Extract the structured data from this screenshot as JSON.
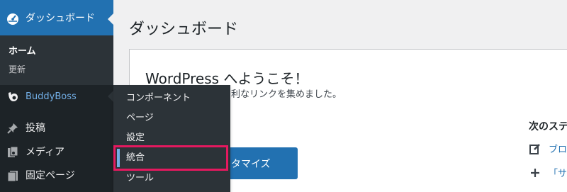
{
  "sidebar": {
    "dashboard_label": "ダッシュボード",
    "submenu": {
      "home": "ホーム",
      "update": "更新"
    },
    "items": [
      {
        "label": "BuddyBoss",
        "icon": "buddyboss-icon"
      },
      {
        "label": "投稿",
        "icon": "pin-icon"
      },
      {
        "label": "メディア",
        "icon": "media-icon"
      },
      {
        "label": "固定ページ",
        "icon": "page-icon"
      }
    ],
    "flyout": [
      "コンポーネント",
      "ページ",
      "設定",
      "統合",
      "ツール"
    ]
  },
  "main": {
    "page_title": "ダッシュボード",
    "welcome_title": "WordPress へようこそ！",
    "welcome_sub": "利なリンクを集めました。",
    "customize_btn": "タマイズ",
    "next_steps_title": "次のステ",
    "next_steps": [
      {
        "text": "ブロ",
        "icon": "edit-icon"
      },
      {
        "text": "「サ",
        "icon": "plus-icon"
      }
    ]
  },
  "colors": {
    "accent": "#2271b1",
    "highlight": "#e5195f",
    "sidebar": "#1d2327"
  }
}
